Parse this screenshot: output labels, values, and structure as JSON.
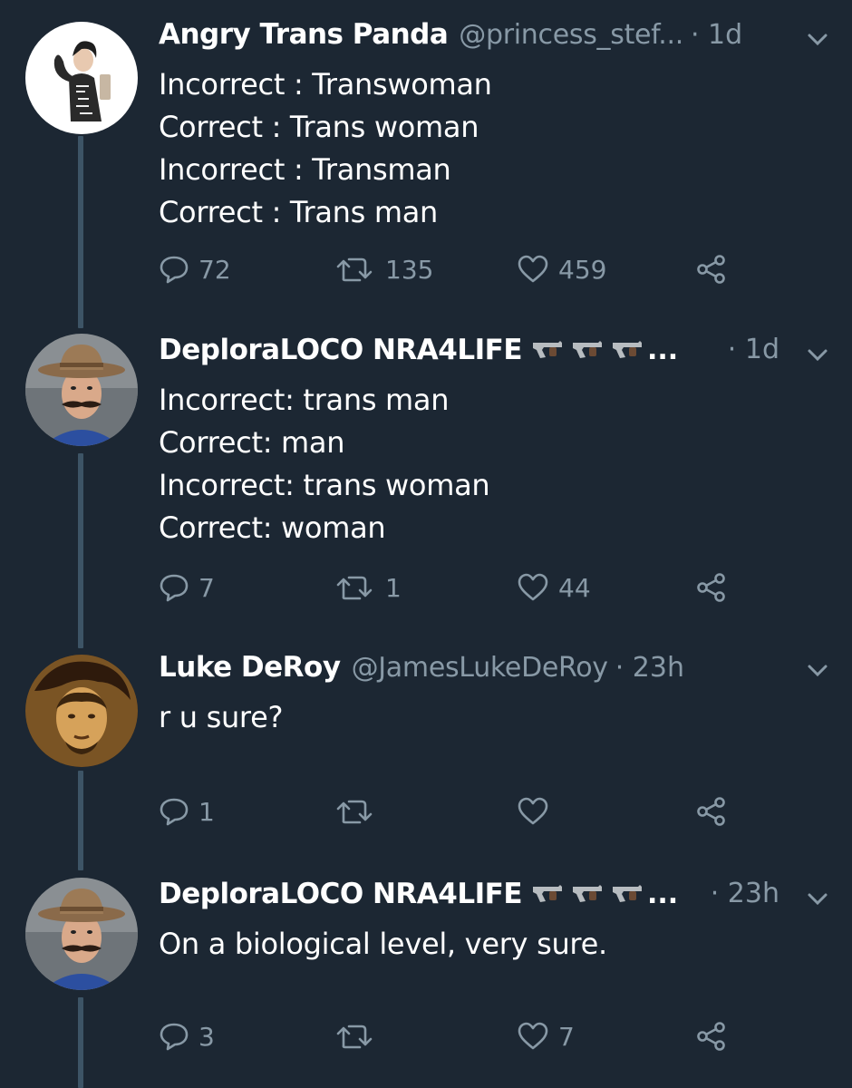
{
  "tweets": [
    {
      "author": "Angry Trans Panda",
      "handle": "@princess_stef...",
      "time": "· 1d",
      "lines": [
        "Incorrect : Transwoman",
        "Correct : Trans woman",
        "Incorrect : Transman",
        "Correct : Trans man"
      ],
      "replies": "72",
      "retweets": "135",
      "likes": "459"
    },
    {
      "author": "DeploraLOCO NRA4LIFE",
      "emoji": [
        "pistol",
        "pistol",
        "pistol"
      ],
      "truncation": "...",
      "time": "· 1d",
      "lines": [
        "Incorrect: trans man",
        "Correct: man",
        "Incorrect: trans woman",
        "Correct: woman"
      ],
      "replies": "7",
      "retweets": "1",
      "likes": "44"
    },
    {
      "author": "Luke DeRoy",
      "handle": "@JamesLukeDeRoy",
      "time": "· 23h",
      "lines": [
        "r u sure?"
      ],
      "replies": "1",
      "retweets": "",
      "likes": ""
    },
    {
      "author": "DeploraLOCO NRA4LIFE",
      "emoji": [
        "pistol",
        "pistol",
        "pistol"
      ],
      "truncation": "...",
      "time": "· 23h",
      "lines": [
        "On a biological level, very sure."
      ],
      "replies": "3",
      "retweets": "",
      "likes": "7"
    }
  ],
  "icons": {
    "reply": "reply-icon",
    "retweet": "retweet-icon",
    "like": "heart-icon",
    "share": "share-icon",
    "menu": "chevron-down-icon"
  },
  "colors": {
    "background": "#1c2733",
    "text": "#ffffff",
    "secondary": "#8899a6",
    "thread_line": "#3d5466"
  }
}
